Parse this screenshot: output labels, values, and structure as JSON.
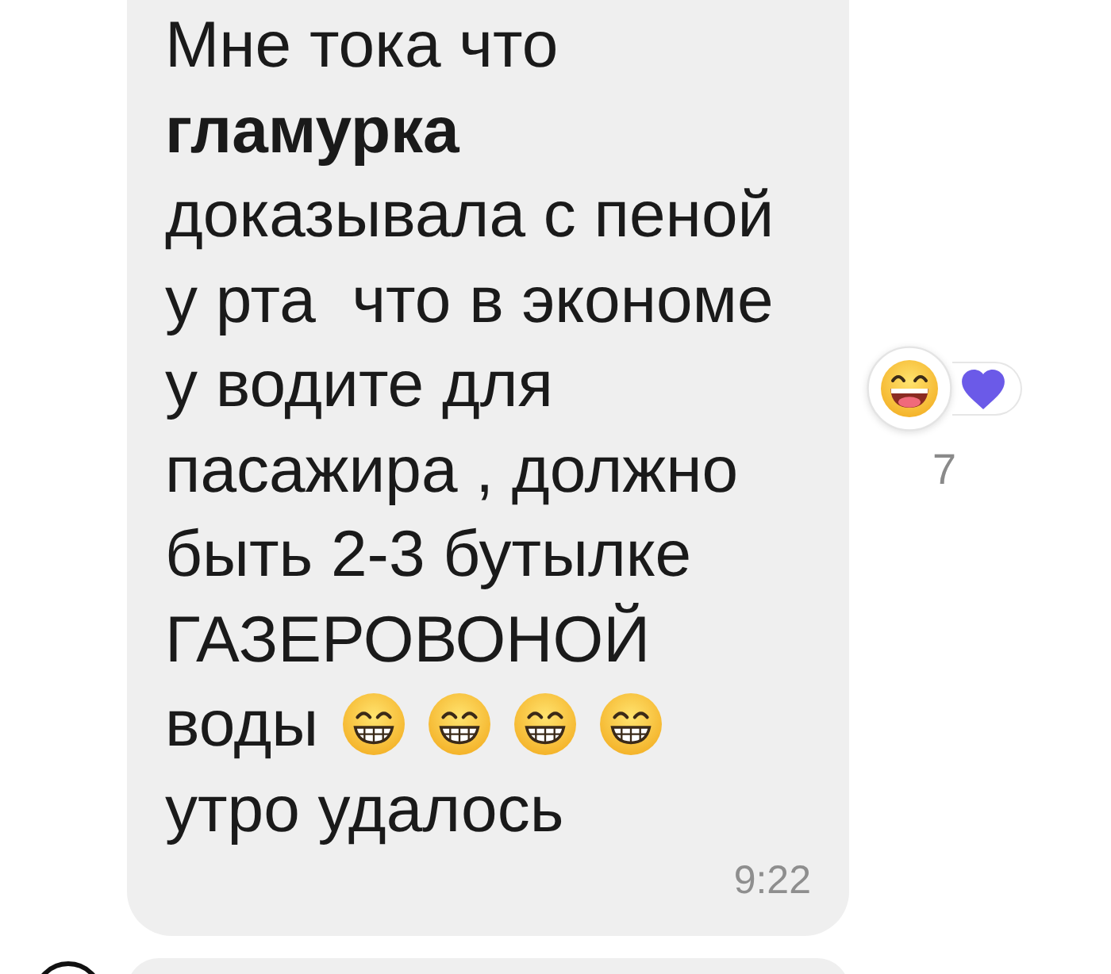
{
  "messages": [
    {
      "avatar": false,
      "content": [
        {
          "kind": "text",
          "text": "Мне тока что **гламурка** доказывала с пеной у рта  что в экономе у водите для пасажира , должно быть 2-3 бутылке ГАЗЕРОВОНОЙ"
        },
        {
          "kind": "text",
          "text": "воды"
        },
        {
          "kind": "emoji"
        },
        {
          "kind": "emoji"
        },
        {
          "kind": "emoji"
        },
        {
          "kind": "emoji"
        },
        {
          "kind": "text",
          "text": "утро удалось"
        }
      ],
      "time": "9:22",
      "reactions": {
        "items": [
          {
            "kind": "laughing"
          },
          {
            "kind": "heart"
          }
        ],
        "count": "7"
      }
    },
    {
      "avatar": true
    }
  ]
}
